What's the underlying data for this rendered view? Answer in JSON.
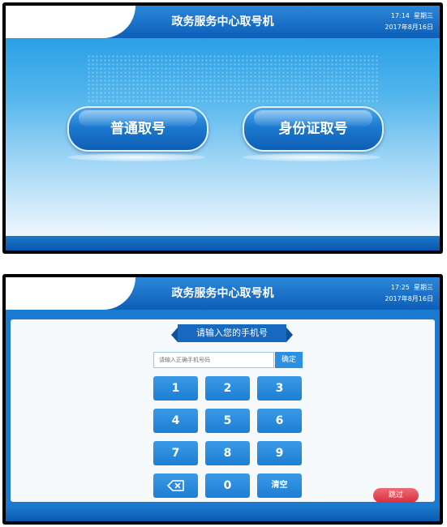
{
  "screen1": {
    "header": {
      "title": "政务服务中心取号机",
      "time": "17:14",
      "weekday": "星期三",
      "date": "2017年8月16日"
    },
    "buttons": {
      "normal": "普通取号",
      "id_card": "身份证取号"
    }
  },
  "screen2": {
    "header": {
      "title": "政务服务中心取号机",
      "time": "17:25",
      "weekday": "星期三",
      "date": "2017年8月16日"
    },
    "prompt": "请输入您的手机号",
    "phone_input": {
      "placeholder": "请输入正确手机号码",
      "value": ""
    },
    "confirm_label": "确定",
    "keypad": [
      "1",
      "2",
      "3",
      "4",
      "5",
      "6",
      "7",
      "8",
      "9",
      "",
      "0",
      "清空"
    ],
    "skip_label": "跳过"
  },
  "colors": {
    "header_blue": "#1b79cf",
    "button_blue": "#2d8fe0",
    "skip_red": "#d62f3e"
  },
  "icons": {
    "backspace": "backspace-icon"
  }
}
